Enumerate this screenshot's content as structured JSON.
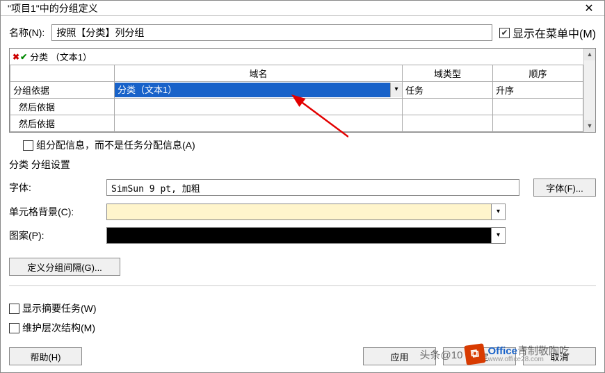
{
  "window": {
    "title": "\"项目1\"中的分组定义"
  },
  "name_row": {
    "label": "名称(N):",
    "value": "按照【分类】列分组",
    "show_in_menu": "显示在菜单中(M)"
  },
  "grid": {
    "top_text": "分类 （文本1）",
    "headers": {
      "domain": "域名",
      "type": "域类型",
      "order": "顺序"
    },
    "left_labels": [
      "分组依据",
      "然后依据",
      "然后依据"
    ],
    "rows": [
      {
        "domain": "分类（文本1）",
        "type": "任务",
        "order": "升序"
      },
      {
        "domain": "",
        "type": "",
        "order": ""
      },
      {
        "domain": "",
        "type": "",
        "order": ""
      }
    ]
  },
  "chk_group_assign": "组分配信息，而不是任务分配信息(A)",
  "section": "分类 分组设置",
  "font_row": {
    "label": "字体:",
    "value": "SimSun 9 pt, 加粗",
    "button": "字体(F)..."
  },
  "bg_row": {
    "label": "单元格背景(C):",
    "color": "#fff5cc"
  },
  "pattern_row": {
    "label": "图案(P):",
    "color": "#000000"
  },
  "define_interval_btn": "定义分组间隔(G)...",
  "chk_summary": "显示摘要任务(W)",
  "chk_hierarchy": "维护层次结构(M)",
  "buttons": {
    "help": "帮助(H)",
    "apply": "应用",
    "ok": "确定",
    "cancel": "取消"
  },
  "watermark": {
    "text1": "头条@10",
    "text2": "青制敬陶吃",
    "sub": "www.office28.com"
  }
}
